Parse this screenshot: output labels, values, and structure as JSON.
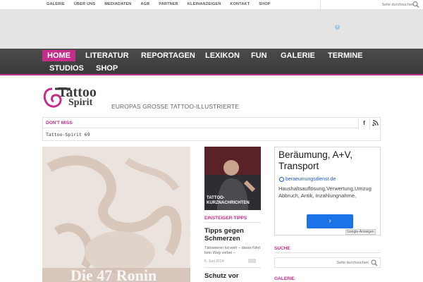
{
  "top_nav": {
    "items": [
      "GALERIE",
      "ÜBER UNS",
      "MEDIADATEN",
      "AGB",
      "PARTNER",
      "KLEINANZEIGEN",
      "KONTAKT",
      "SHOP"
    ],
    "search_placeholder": "Seite durchsuchen"
  },
  "ad_banner": {
    "info_icon": "info-icon"
  },
  "main_nav": {
    "items": [
      "HOME",
      "LITERATUR",
      "REPORTAGEN",
      "LEXIKON",
      "FUN",
      "GALERIE",
      "TERMINE",
      "STUDIOS",
      "SHOP"
    ],
    "active": "HOME"
  },
  "brand": {
    "logo_line1": "Tattoo",
    "logo_line2": "Spirit",
    "tagline": "EUROPAS GROSSE TATTOO-ILLUSTRIERTE"
  },
  "dont_miss": {
    "label": "DON'T MISS",
    "ticker": "Tattoo-Spirit 69",
    "social": [
      "facebook-icon",
      "rss-icon"
    ]
  },
  "feature": {
    "caption": "Die 47 Ronin"
  },
  "kurznachrichten": {
    "label": "TATTOO-KURZNACHRICHTEN"
  },
  "einsteiger": {
    "label": "EINSTEIGER-TIPPS",
    "article1": {
      "title": "Tipps gegen Schmerzen",
      "excerpt": "Tätowieren tut weh – daran führt kein Weg vorbei –",
      "date": "5. Juni 2014"
    },
    "article2": {
      "title": "Schutz vor"
    }
  },
  "ad": {
    "headline": "Beräumung, A+V, Transport",
    "url": "beraeumungsdienst.de",
    "description": "Haushaltsauflösung,Verwertung,Umzug Abbruch, Antik, Inzahlungnahme,",
    "arrow": "›",
    "badge": "Google-Anzeigen"
  },
  "suche": {
    "label": "SUCHE",
    "placeholder": "Seite durchsuchen"
  },
  "galerie": {
    "label": "GALERIE"
  },
  "colors": {
    "accent": "#c42e8b",
    "nav_bg": "#444444",
    "link_blue": "#1a5bc4"
  }
}
